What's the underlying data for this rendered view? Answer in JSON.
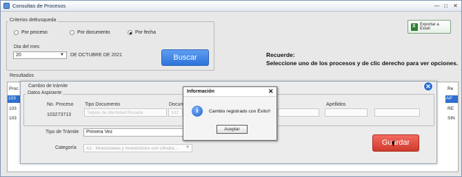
{
  "window": {
    "title": "Consultas de Procesos",
    "min": "—",
    "max": "□",
    "close": "✕"
  },
  "criterios": {
    "legend": "Criterios deBusqueda",
    "options": [
      "Por proceso",
      "Por documento",
      "Por fecha"
    ],
    "selected": "Por fecha",
    "dia_label": "Dia del mes",
    "dia_value": "20",
    "month_text": "DE OCTUBRE DE 2021",
    "buscar_label": "Buscar"
  },
  "export_label": "Exportar a Excel",
  "recuerde": {
    "title": "Recuerde:",
    "text": "Seleccione uno de los procesos y de clic derecho para ver opciones."
  },
  "resultados": {
    "legend": "Resultados",
    "left_cells": [
      "Proc",
      "103",
      "103",
      "103"
    ],
    "right_cells": [
      "Re",
      "AP",
      "RE",
      "SIN"
    ]
  },
  "cambio": {
    "title": "Cambio de trámite",
    "datos_legend": "Datos Aspirante",
    "no_proceso_label": "No. Proceso",
    "no_proceso_value": "103273713",
    "tipo_doc_label": "Tipo Documento",
    "tipo_doc_value": "Tarjeta de Identidad Rosada",
    "documento_label": "Docum",
    "documento_value": "102",
    "apellidos_label": "Apellidos",
    "tipo_tramite_label": "Tipo de Trámite",
    "tipo_tramite_value": "Primera Vez",
    "categoria_label": "Categoría",
    "categoria_value": "A2 - Motocicletas y mototriciclos con cilindra...",
    "guardar_label": "Guardar"
  },
  "dialog": {
    "title": "Información",
    "message": "Cambio registrado con Éxito!!",
    "aceptar": "Aceptar"
  },
  "colors": {
    "buscar": "#2c74dc",
    "guardar": "#cf3a2d",
    "selection": "#2f6fd0"
  }
}
